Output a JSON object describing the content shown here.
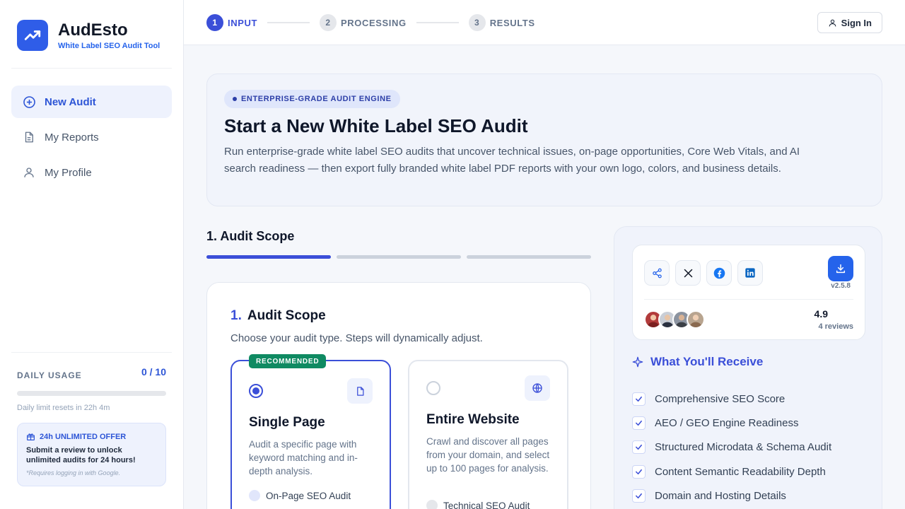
{
  "brand": {
    "name": "AudEsto",
    "tagline": "White Label SEO Audit Tool"
  },
  "sidebar": {
    "items": [
      {
        "label": "New Audit",
        "icon": "plus-circle-icon",
        "active": true
      },
      {
        "label": "My Reports",
        "icon": "document-icon",
        "active": false
      },
      {
        "label": "My Profile",
        "icon": "user-icon",
        "active": false
      }
    ],
    "usage": {
      "label": "DAILY USAGE",
      "count": "0 / 10",
      "fraction": 0,
      "reset": "Daily limit resets in 22h 4m"
    },
    "offer": {
      "title": "24h UNLIMITED OFFER",
      "text": "Submit a review to unlock unlimited audits for 24 hours!",
      "note": "*Requires logging in with Google."
    }
  },
  "steps": [
    {
      "num": "1",
      "label": "INPUT",
      "active": true
    },
    {
      "num": "2",
      "label": "PROCESSING",
      "active": false
    },
    {
      "num": "3",
      "label": "RESULTS",
      "active": false
    }
  ],
  "header": {
    "signin": "Sign In"
  },
  "hero": {
    "badge": "ENTERPRISE-GRADE AUDIT ENGINE",
    "title": "Start a New White Label SEO Audit",
    "description": "Run enterprise-grade white label SEO audits that uncover technical issues, on-page opportunities, Core Web Vitals, and AI search readiness — then export fully branded white label PDF reports with your own logo, colors, and business details."
  },
  "scope": {
    "heading": "1. Audit Scope",
    "card_number": "1.",
    "card_title": "Audit Scope",
    "card_sub": "Choose your audit type. Steps will dynamically adjust.",
    "options": [
      {
        "badge": "RECOMMENDED",
        "title": "Single Page",
        "description": "Audit a specific page with keyword matching and in-depth analysis.",
        "feature": "On-Page SEO Audit",
        "icon": "file-icon",
        "selected": true
      },
      {
        "title": "Entire Website",
        "description": "Crawl and discover all pages from your domain, and select up to 100 pages for analysis.",
        "feature": "Technical SEO Audit",
        "icon": "globe-icon",
        "selected": false
      }
    ]
  },
  "share": {
    "version": "v2.5.8",
    "rating": "4.9",
    "reviews": "4 reviews"
  },
  "receive": {
    "title": "What You'll Receive",
    "items": [
      "Comprehensive SEO Score",
      "AEO / GEO Engine Readiness",
      "Structured Microdata & Schema Audit",
      "Content Semantic Readability Depth",
      "Domain and Hosting Details"
    ]
  },
  "colors": {
    "accent": "#3b4fd8",
    "brand": "#2f5de8",
    "recommended": "#0f8a62"
  }
}
